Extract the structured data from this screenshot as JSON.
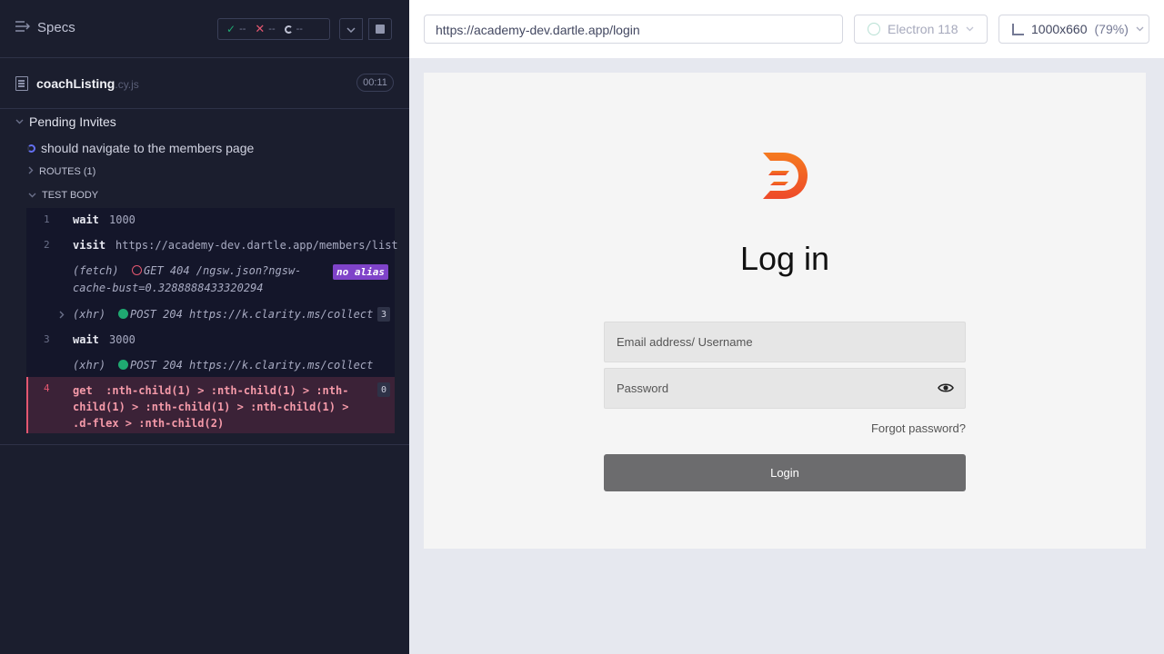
{
  "reporter": {
    "specs_label": "Specs",
    "stats": {
      "passed": "--",
      "failed": "--",
      "pending": "--"
    },
    "spec": {
      "name": "coachListing",
      "ext": ".cy.js",
      "duration": "00:11"
    },
    "suite_title": "Pending Invites",
    "test_title": "should navigate to the members page",
    "routes_label": "ROUTES (1)",
    "test_body_label": "TEST BODY",
    "commands": [
      {
        "num": "1",
        "name": "wait",
        "message": "1000"
      },
      {
        "num": "2",
        "name": "visit",
        "message": "https://academy-dev.dartle.app/members/list"
      },
      {
        "name": "(fetch)",
        "message_line1": "GET 404 /ngsw.json?ngsw-",
        "message_line2": "cache-bust=0.3288888433320294",
        "badge": "no alias"
      },
      {
        "name": "(xhr)",
        "message": "POST 204 https://k.clarity.ms/collect",
        "count": "3"
      },
      {
        "num": "3",
        "name": "wait",
        "message": "3000"
      },
      {
        "name": "(xhr)",
        "message": "POST 204 https://k.clarity.ms/collect"
      },
      {
        "num": "4",
        "name": "get",
        "message": ":nth-child(1) > :nth-child(1) > :nth-child(1) > :nth-child(1) > :nth-child(1) > .d-flex > :nth-child(2)",
        "count": "0"
      }
    ]
  },
  "aut": {
    "url": "https://academy-dev.dartle.app/login",
    "browser": "Electron 118",
    "viewport": "1000x660",
    "zoom": "(79%)",
    "page": {
      "title": "Log in",
      "email_placeholder": "Email address/ Username",
      "password_placeholder": "Password",
      "forgot_label": "Forgot password?",
      "login_label": "Login"
    }
  },
  "colors": {
    "reporter_bg": "#1b1e2e",
    "pass": "#1fa971",
    "fail": "#e45770",
    "alias_badge": "#7f43c9",
    "login_button": "#6c6c6e",
    "logo_orange": "#f26b21"
  }
}
